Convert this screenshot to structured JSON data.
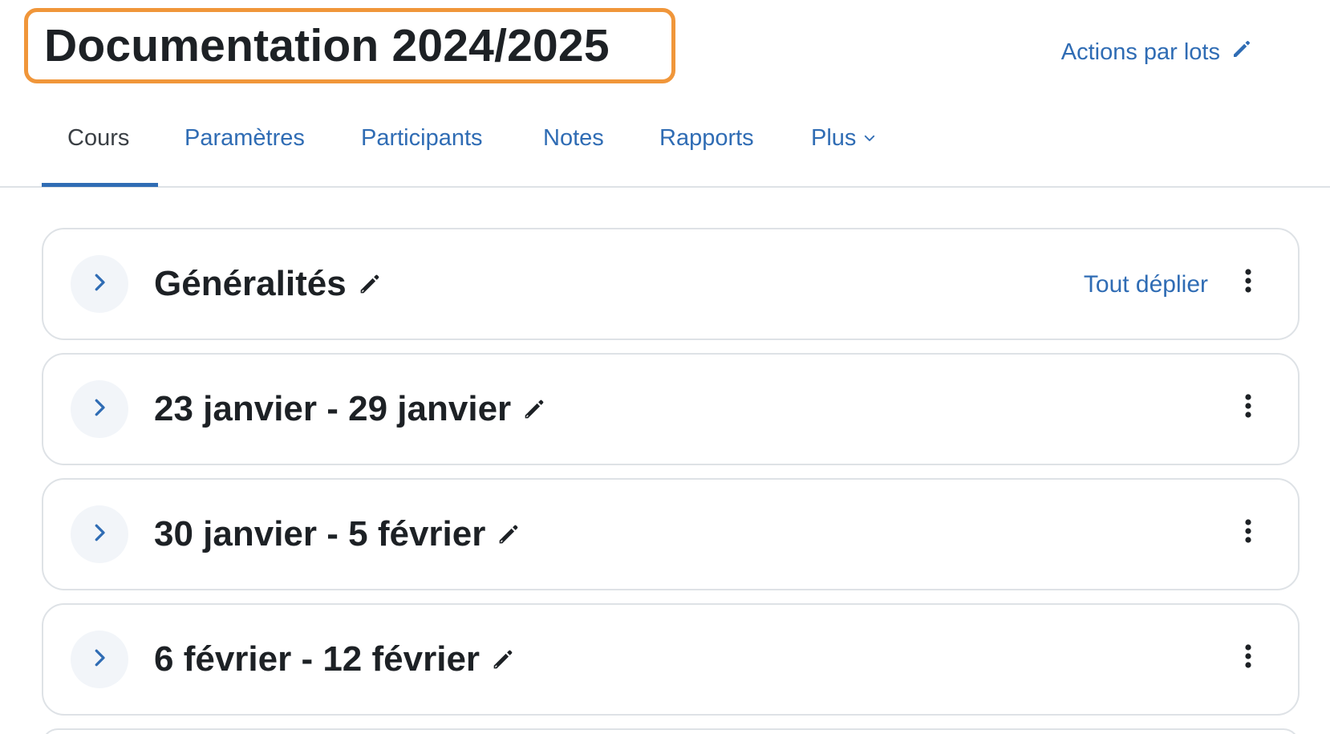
{
  "header": {
    "title": "Documentation 2024/2025",
    "bulk_actions_label": "Actions par lots"
  },
  "tabs": [
    {
      "label": "Cours",
      "active": true
    },
    {
      "label": "Paramètres"
    },
    {
      "label": "Participants"
    },
    {
      "label": "Notes"
    },
    {
      "label": "Rapports"
    },
    {
      "label": "Plus"
    }
  ],
  "sections": [
    {
      "title": "Généralités",
      "expand_all_label": "Tout déplier"
    },
    {
      "title": "23 janvier - 29 janvier"
    },
    {
      "title": "30 janvier - 5 février"
    },
    {
      "title": "6 février - 12 février"
    }
  ],
  "colors": {
    "accent": "#2f6cb4",
    "highlight_border": "#f0963a",
    "text": "#1d2125",
    "border": "#dee2e6"
  },
  "icons": {
    "bulk_actions": "pencil-icon",
    "tab_more": "chevron-down-icon",
    "section_toggle": "chevron-right-icon",
    "section_edit": "pencil-icon",
    "section_menu": "kebab-menu-icon"
  }
}
